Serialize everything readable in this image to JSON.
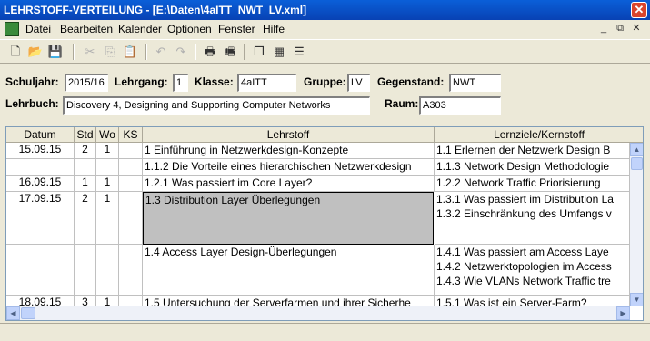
{
  "window": {
    "title": "LEHRSTOFF-VERTEILUNG - [E:\\Daten\\4aITT_NWT_LV.xml]"
  },
  "menu": [
    "Datei",
    "Bearbeiten",
    "Kalender",
    "Optionen",
    "Fenster",
    "Hilfe"
  ],
  "mdi_controls": [
    "_",
    "⧉",
    "✕"
  ],
  "toolbar_icons": [
    "new-document-icon",
    "open-folder-icon",
    "save-icon",
    "cut-icon",
    "copy-icon",
    "paste-icon",
    "undo-icon",
    "redo-icon",
    "print-icon",
    "print-preview-icon",
    "window-icon",
    "calendar-icon",
    "list-icon"
  ],
  "form": {
    "schuljahr_label": "Schuljahr:",
    "schuljahr": "2015/16",
    "lehrgang_label": "Lehrgang:",
    "lehrgang": "1",
    "klasse_label": "Klasse:",
    "klasse": "4aITT",
    "gruppe_label": "Gruppe:",
    "gruppe": "LV",
    "gegenstand_label": "Gegenstand:",
    "gegenstand": "NWT",
    "lehrbuch_label": "Lehrbuch:",
    "lehrbuch": "Discovery 4, Designing and Supporting Computer Networks",
    "raum_label": "Raum:",
    "raum": "A303"
  },
  "table": {
    "columns": [
      "Datum",
      "Std",
      "Wo",
      "KS",
      "Lehrstoff",
      "Lernziele/Kernstoff"
    ],
    "rows": [
      {
        "datum": "15.09.15",
        "std": "2",
        "wo": "1",
        "ks": "",
        "lehrstoff": [
          "1 Einführung in Netzwerkdesign-Konzepte"
        ],
        "lernziele": [
          "1.1 Erlernen der Netzwerk Design B"
        ]
      },
      {
        "datum": "",
        "std": "",
        "wo": "",
        "ks": "",
        "lehrstoff": [
          "1.1.2 Die Vorteile eines hierarchischen Netzwerkdesign"
        ],
        "lernziele": [
          "1.1.3 Network Design Methodologie"
        ]
      },
      {
        "datum": "16.09.15",
        "std": "1",
        "wo": "1",
        "ks": "",
        "lehrstoff": [
          "1.2.1 Was passiert im Core Layer?"
        ],
        "lernziele": [
          "1.2.2 Network Traffic Priorisierung"
        ]
      },
      {
        "datum": "17.09.15",
        "std": "2",
        "wo": "1",
        "ks": "",
        "lehrstoff": [
          "1.3 Distribution Layer Überlegungen"
        ],
        "lernziele": [
          "1.3.1 Was passiert im Distribution La",
          "1.3.2 Einschränkung des Umfangs v"
        ]
      },
      {
        "datum": "",
        "std": "",
        "wo": "",
        "ks": "",
        "lehrstoff": [
          "1.4 Access Layer Design-Überlegungen"
        ],
        "lernziele": [
          "1.4.1 Was passiert am Access Laye",
          "1.4.2 Netzwerktopologien im Access",
          "1.4.3 Wie VLANs Network Traffic tre"
        ]
      },
      {
        "datum": "18.09.15",
        "std": "3",
        "wo": "1",
        "ks": "",
        "lehrstoff": [
          "1.5 Untersuchung der Serverfarmen und ihrer Sicherhe"
        ],
        "lernziele": [
          "1.5.1 Was ist ein Server-Farm?"
        ]
      }
    ]
  }
}
